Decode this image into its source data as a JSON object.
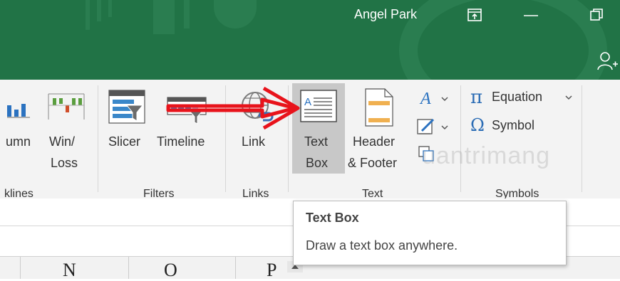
{
  "titlebar": {
    "user_name": "Angel Park",
    "restore_icon": "ribbon-display-icon",
    "minimize_icon": "minimize-icon",
    "maximize_icon": "restore-down-icon",
    "share_icon": "share-person-icon",
    "color": "#217346"
  },
  "ribbon": {
    "sparklines": {
      "column_label": "umn",
      "winloss_label_line1": "Win/",
      "winloss_label_line2": "Loss",
      "group_label": "klines"
    },
    "filters": {
      "slicer_label": "Slicer",
      "timeline_label": "Timeline",
      "group_label": "Filters"
    },
    "links": {
      "link_label": "Link",
      "group_label": "Links"
    },
    "text": {
      "textbox_label_line1": "Text",
      "textbox_label_line2": "Box",
      "header_label_line1": "Header",
      "header_label_line2": "& Footer",
      "group_label": "Text"
    },
    "symbols": {
      "equation_label": "Equation",
      "symbol_label": "Symbol",
      "group_label": "Symbols"
    }
  },
  "tooltip": {
    "title": "Text Box",
    "description": "Draw a text box anywhere."
  },
  "columns": [
    "N",
    "O",
    "P"
  ],
  "watermark": "uantrimang",
  "colors": {
    "accent_green": "#217346",
    "arrow_red": "#e8131b",
    "hover_gray": "#c8c8c8"
  }
}
